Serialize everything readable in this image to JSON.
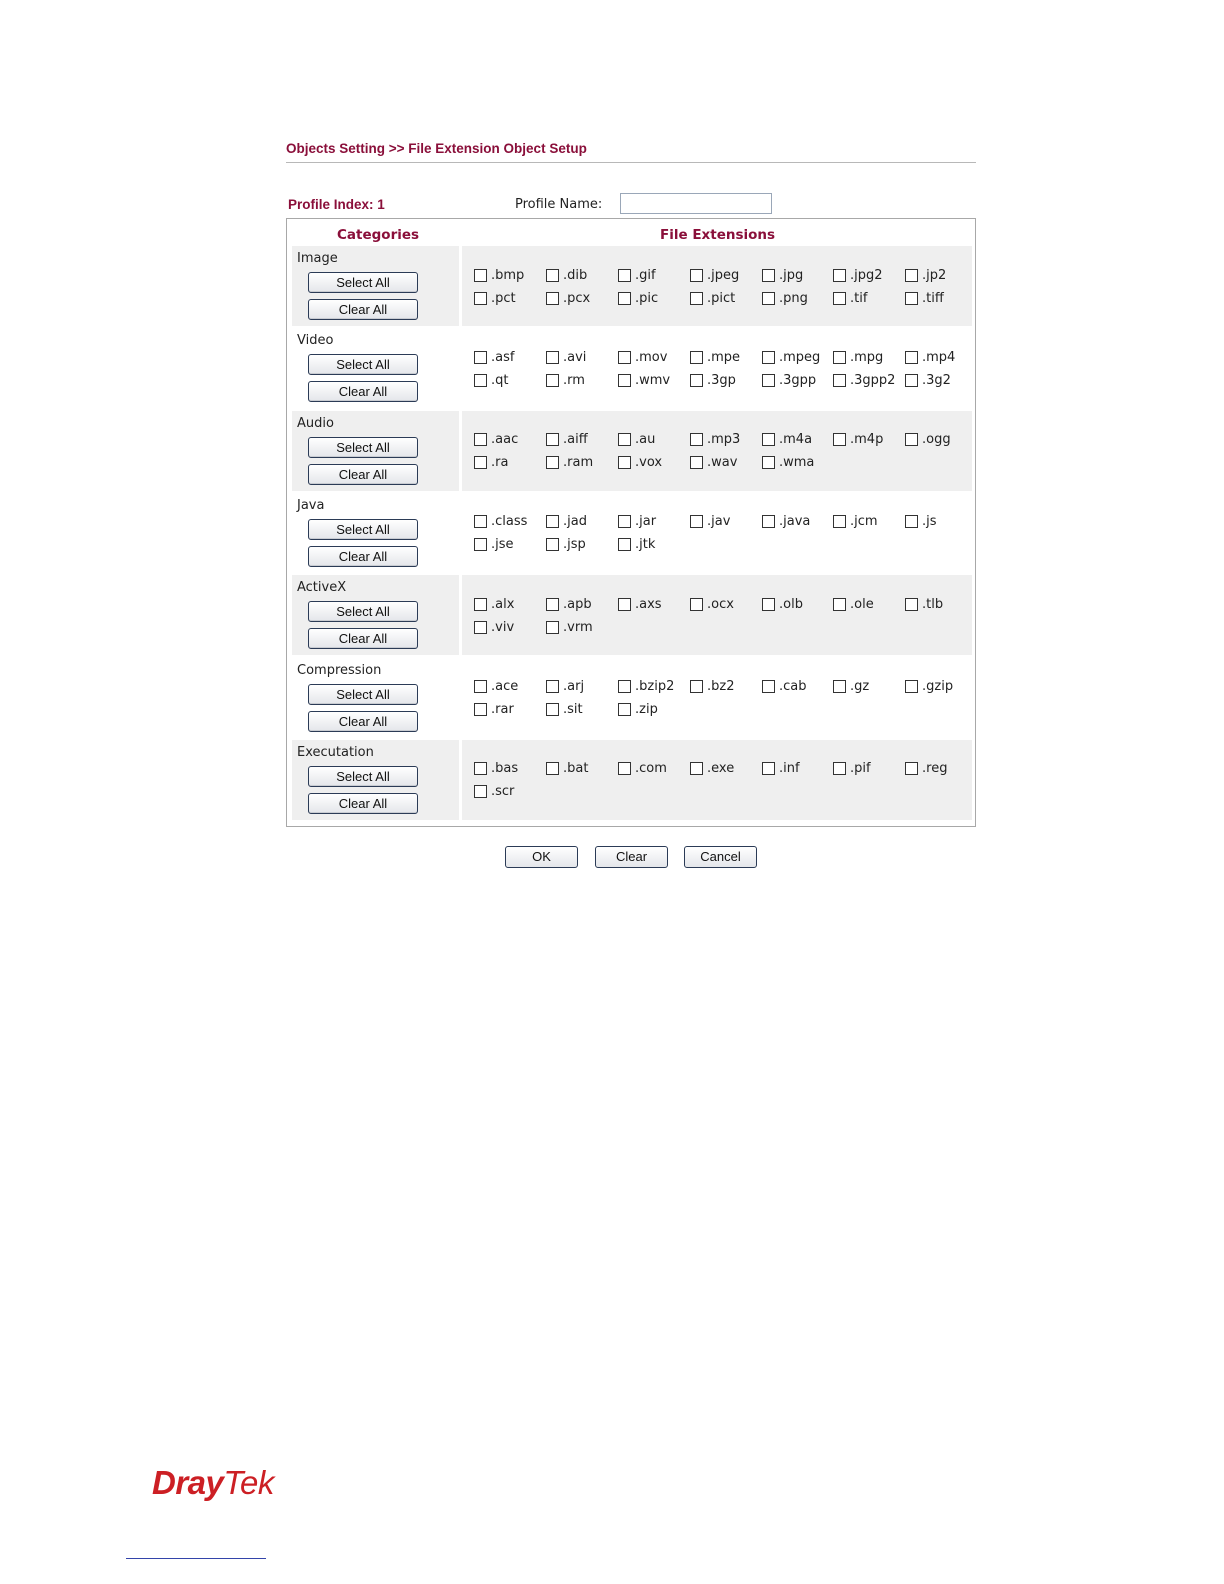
{
  "breadcrumb": "Objects Setting >> File Extension Object Setup",
  "profile": {
    "index_label": "Profile Index: 1",
    "name_label": "Profile Name:",
    "name_value": ""
  },
  "table": {
    "col_categories": "Categories",
    "col_extensions": "File Extensions"
  },
  "buttons": {
    "select_all": "Select All",
    "clear_all": "Clear All",
    "ok": "OK",
    "clear": "Clear",
    "cancel": "Cancel"
  },
  "categories": [
    {
      "name": "Image",
      "extensions": [
        ".bmp",
        ".dib",
        ".gif",
        ".jpeg",
        ".jpg",
        ".jpg2",
        ".jp2",
        ".pct",
        ".pcx",
        ".pic",
        ".pict",
        ".png",
        ".tif",
        ".tiff"
      ]
    },
    {
      "name": "Video",
      "extensions": [
        ".asf",
        ".avi",
        ".mov",
        ".mpe",
        ".mpeg",
        ".mpg",
        ".mp4",
        ".qt",
        ".rm",
        ".wmv",
        ".3gp",
        ".3gpp",
        ".3gpp2",
        ".3g2"
      ]
    },
    {
      "name": "Audio",
      "extensions": [
        ".aac",
        ".aiff",
        ".au",
        ".mp3",
        ".m4a",
        ".m4p",
        ".ogg",
        ".ra",
        ".ram",
        ".vox",
        ".wav",
        ".wma"
      ]
    },
    {
      "name": "Java",
      "extensions": [
        ".class",
        ".jad",
        ".jar",
        ".jav",
        ".java",
        ".jcm",
        ".js",
        ".jse",
        ".jsp",
        ".jtk"
      ]
    },
    {
      "name": "ActiveX",
      "extensions": [
        ".alx",
        ".apb",
        ".axs",
        ".ocx",
        ".olb",
        ".ole",
        ".tlb",
        ".viv",
        ".vrm"
      ]
    },
    {
      "name": "Compression",
      "extensions": [
        ".ace",
        ".arj",
        ".bzip2",
        ".bz2",
        ".cab",
        ".gz",
        ".gzip",
        ".rar",
        ".sit",
        ".zip"
      ]
    },
    {
      "name": "Executation",
      "extensions": [
        ".bas",
        ".bat",
        ".com",
        ".exe",
        ".inf",
        ".pif",
        ".reg",
        ".scr"
      ]
    }
  ],
  "logo": {
    "part1": "Dray",
    "part2": "Tek"
  },
  "colors": {
    "accent": "#8a0f3a",
    "row_shade": "#efefef",
    "logo": "#cc1f24"
  }
}
